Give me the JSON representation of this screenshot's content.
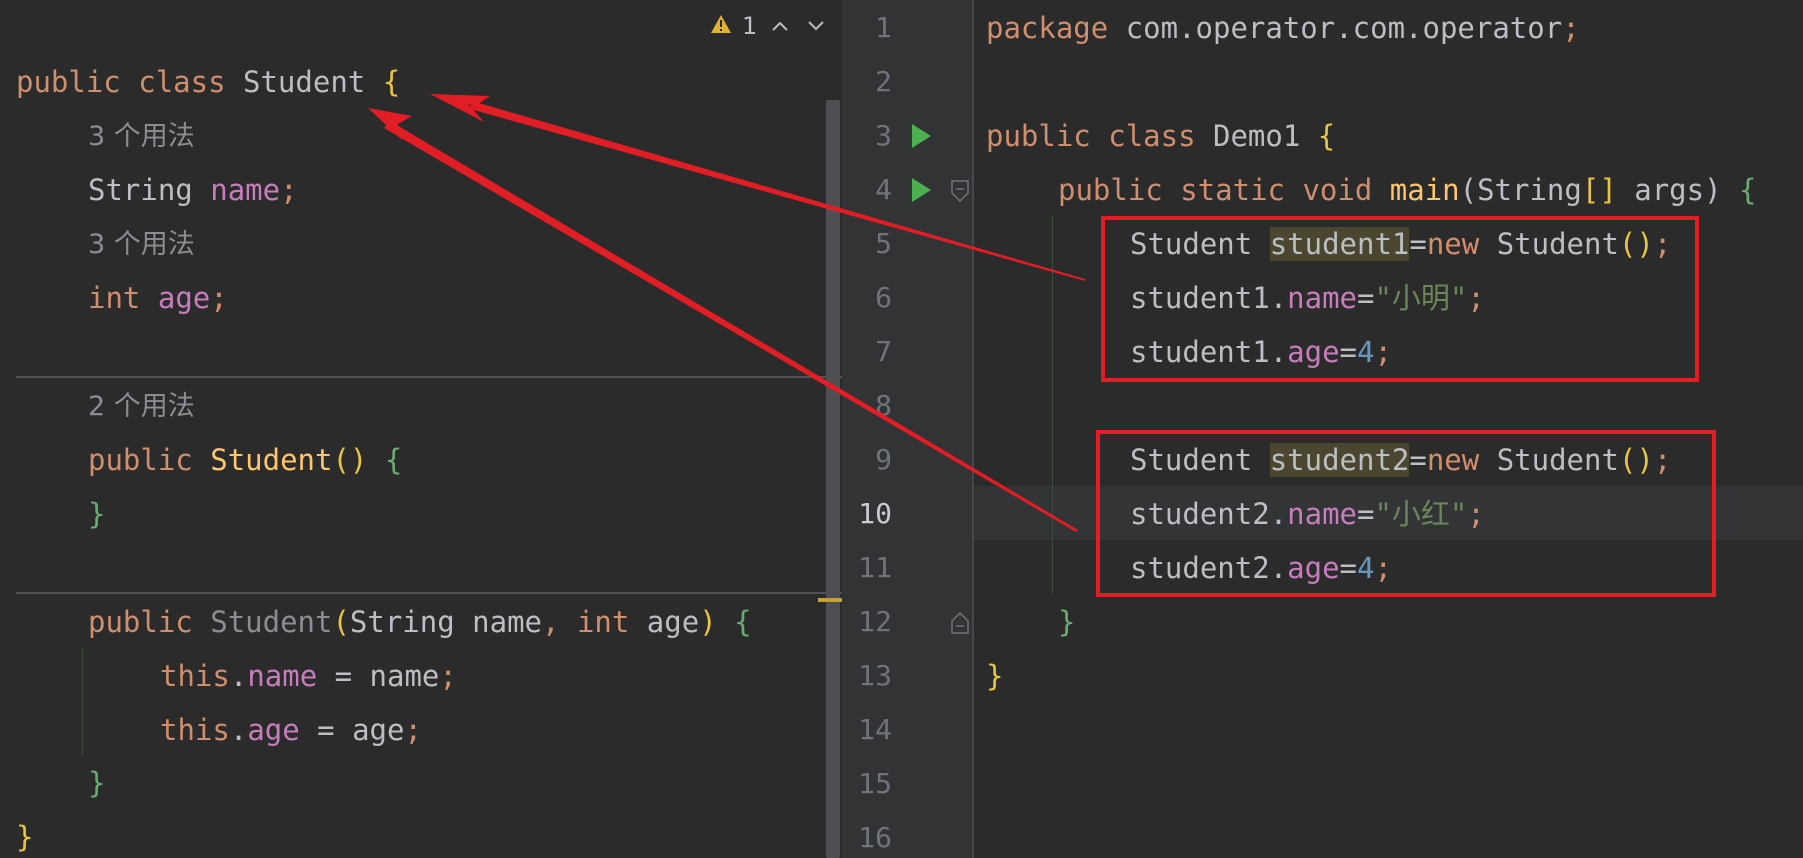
{
  "left_editor": {
    "inspections": {
      "warning_count": "1"
    },
    "line1": {
      "public": "public",
      "class": "class",
      "name": "Student",
      "open": "{"
    },
    "usage_hint_1": "3 个用法",
    "line_field_name": {
      "type": "String",
      "name": "name",
      "semi": ";"
    },
    "usage_hint_2": "3 个用法",
    "line_field_age": {
      "type": "int",
      "name": "age",
      "semi": ";"
    },
    "usage_hint_3": "2 个用法",
    "ctor1": {
      "public": "public",
      "name": "Student",
      "parens": "()",
      "open": "{"
    },
    "ctor1_close": "}",
    "ctor2": {
      "public": "public",
      "name": "Student",
      "lp": "(",
      "ptype1": "String",
      "pname1": "name",
      "comma": ",",
      "ptype2": "int",
      "pname2": "age",
      "rp": ")",
      "open": "{"
    },
    "assign1": {
      "this": "this",
      "dot": ".",
      "field": "name",
      "eq": " = ",
      "val": "name",
      "semi": ";"
    },
    "assign2": {
      "this": "this",
      "dot": ".",
      "field": "age",
      "eq": " = ",
      "val": "age",
      "semi": ";"
    },
    "ctor2_close": "}",
    "class_close": "}"
  },
  "right_editor": {
    "line_numbers": [
      "1",
      "2",
      "3",
      "4",
      "5",
      "6",
      "7",
      "8",
      "9",
      "10",
      "11",
      "12",
      "13",
      "14",
      "15",
      "16"
    ],
    "current_line": "10",
    "l1": {
      "kw": "package",
      "pkg": "com.operator.com.operator",
      "semi": ";"
    },
    "l3": {
      "public": "public",
      "class": "class",
      "name": "Demo1",
      "open": "{"
    },
    "l4": {
      "public": "public",
      "static": "static",
      "void": "void",
      "main": "main",
      "lp": "(",
      "type": "String",
      "arr": "[]",
      "arg": "args",
      "rp": ")",
      "open": "{"
    },
    "l5": {
      "type": "Student",
      "var": "student1",
      "eq": "=",
      "new": "new",
      "ctor": "Student",
      "parens": "()",
      "semi": ";"
    },
    "l6": {
      "obj": "student1",
      "dot": ".",
      "field": "name",
      "eq": "=",
      "str": "\"小明\"",
      "semi": ";"
    },
    "l7": {
      "obj": "student1",
      "dot": ".",
      "field": "age",
      "eq": "=",
      "num": "4",
      "semi": ";"
    },
    "l9": {
      "type": "Student",
      "var": "student2",
      "eq": "=",
      "new": "new",
      "ctor": "Student",
      "parens": "()",
      "semi": ";"
    },
    "l10": {
      "obj": "student2",
      "dot": ".",
      "field": "name",
      "eq": "=",
      "str": "\"小红\"",
      "semi": ";"
    },
    "l11": {
      "obj": "student2",
      "dot": ".",
      "field": "age",
      "eq": "=",
      "num": "4",
      "semi": ";"
    },
    "l12": "}",
    "l13": "}"
  },
  "colors": {
    "annotation_red": "#e11d25",
    "keyword": "#cf8e6d",
    "field": "#c77dbb",
    "function": "#ffc66d",
    "string": "#6a8759",
    "number": "#6897bb",
    "run_green": "#4caf50"
  },
  "icons": [
    "warning-icon",
    "chevron-up-icon",
    "chevron-down-icon",
    "run-icon",
    "fold-icon"
  ]
}
